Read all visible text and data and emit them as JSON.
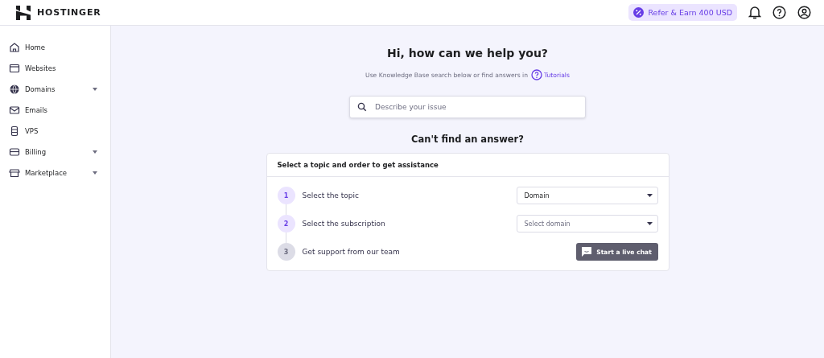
{
  "header": {
    "brand": "HOSTINGER",
    "refer_button": "Refer & Earn 400 USD"
  },
  "sidebar": {
    "items": [
      {
        "label": "Home",
        "expandable": false
      },
      {
        "label": "Websites",
        "expandable": false
      },
      {
        "label": "Domains",
        "expandable": true
      },
      {
        "label": "Emails",
        "expandable": false
      },
      {
        "label": "VPS",
        "expandable": false
      },
      {
        "label": "Billing",
        "expandable": true
      },
      {
        "label": "Marketplace",
        "expandable": true
      }
    ]
  },
  "help": {
    "title": "Hi, how can we help you?",
    "subtitle": "Use Knowledge Base search below or find answers in",
    "tutorials_link": "Tutorials",
    "search": {
      "placeholder": "Describe your issue"
    },
    "cant_find": "Can't find an answer?"
  },
  "assist_card": {
    "title": "Select a topic and order to get assistance",
    "steps": [
      {
        "number": "1",
        "label": "Select the topic",
        "active": true,
        "kind": "select",
        "value": "Domain"
      },
      {
        "number": "2",
        "label": "Select the subscription",
        "active": true,
        "kind": "select",
        "placeholder": "Select domain"
      },
      {
        "number": "3",
        "label": "Get support from our team",
        "active": false,
        "kind": "button",
        "button": "Start a live chat"
      }
    ]
  }
}
